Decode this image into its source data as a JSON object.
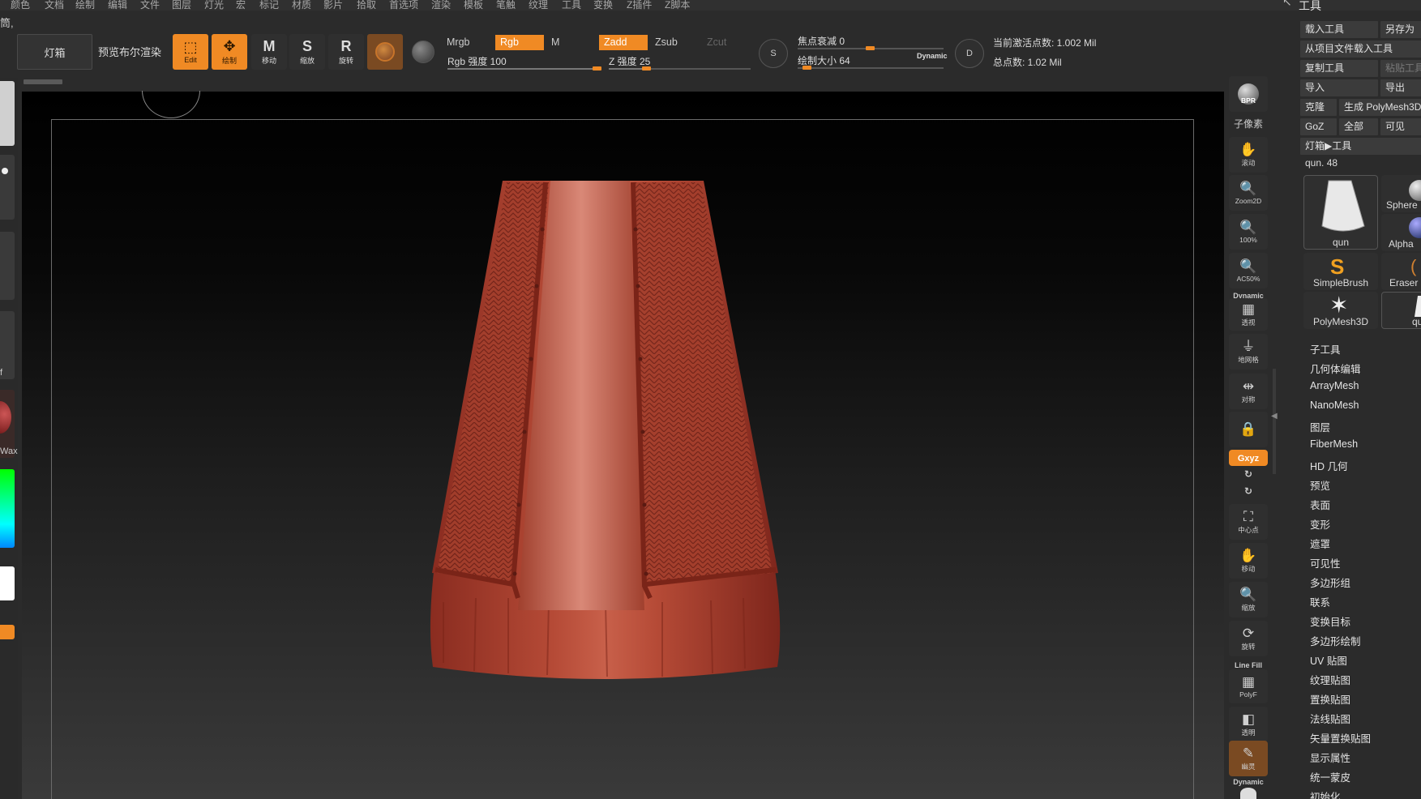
{
  "menubar": {
    "items": [
      "颜色",
      "文档",
      "绘制",
      "编辑",
      "文件",
      "图层",
      "灯光",
      "宏",
      "标记",
      "材质",
      "影片",
      "拾取",
      "首选项",
      "渲染",
      "模板",
      "笔触",
      "纹理",
      "工具",
      "变换",
      "Z插件",
      "Z脚本"
    ],
    "right_title": "工具"
  },
  "subtitle_glyph": "筒,",
  "shelf": {
    "lightbox_label": "灯箱",
    "preview_render_label": "预览布尔渲染",
    "edit_label": "Edit",
    "draw_label": "绘制",
    "move_label": "移动",
    "scale_label": "缩放",
    "rotate_label": "旋转",
    "move_letter": "M",
    "scale_letter": "S",
    "rotate_letter": "R",
    "mrgb": "Mrgb",
    "rgb": "Rgb",
    "m": "M",
    "zadd": "Zadd",
    "zsub": "Zsub",
    "zcut": "Zcut",
    "rgb_intensity_label": "Rgb 强度 100",
    "rgb_intensity_value": 100,
    "z_intensity_label": "Z 强度 25",
    "z_intensity_value": 25,
    "focal_shift_label": "焦点衰减 0",
    "focal_shift_value": 0,
    "draw_size_label": "绘制大小 64",
    "draw_size_value": 64,
    "dynamic_label": "Dynamic",
    "s_label": "S",
    "d_label": "D",
    "active_points": "当前激活点数: 1.002 Mil",
    "total_points": "总点数: 1.02 Mil"
  },
  "left_tray": {
    "wax_label": "Wax",
    "f_label": "f"
  },
  "right_bar": {
    "bpr": "BPR",
    "subpixel": "子像素",
    "scroll": "滚动",
    "zoom2d": "Zoom2D",
    "pct100": "100%",
    "ac50": "AC50%",
    "dynamic": "Dynamic",
    "persp": "透视",
    "floor": "地网格",
    "sym": "对称",
    "lock": "",
    "xyz": "Gxyz",
    "center": "中心点",
    "move": "移动",
    "scale": "缩放",
    "rotate": "旋转",
    "linefill": "Line Fill",
    "polyf": "PolyF",
    "transp": "透明",
    "ghost": "幽灵",
    "dynamic2": "Dynamic"
  },
  "tool_panel": {
    "load_tool": "载入工具",
    "save_as": "另存为",
    "load_from_project": "从项目文件载入工具",
    "copy_tool": "复制工具",
    "paste_tool": "粘贴工具",
    "import": "导入",
    "export": "导出",
    "clone": "克隆",
    "make_polymesh": "生成 PolyMesh3D",
    "goz": "GoZ",
    "all": "全部",
    "visible": "可见",
    "lightbox_tool": "灯箱▶工具",
    "current_tool": "qun. 48",
    "thumbs": [
      {
        "label": "qun"
      },
      {
        "label": "Sphere"
      },
      {
        "label": "Alpha"
      },
      {
        "label": "SimpleBrush"
      },
      {
        "label": "Eraser"
      },
      {
        "label": "PolyMesh3D"
      },
      {
        "label": "qu"
      }
    ],
    "sections": [
      "子工具",
      "几何体编辑",
      "ArrayMesh",
      "NanoMesh",
      "图层",
      "FiberMesh",
      "HD 几何",
      "预览",
      "表面",
      "变形",
      "遮罩",
      "可见性",
      "多边形组",
      "联系",
      "变换目标",
      "多边形绘制",
      "UV 贴图",
      "纹理贴图",
      "置换贴图",
      "法线贴图",
      "矢量置换贴图",
      "显示属性",
      "统一蒙皮",
      "初始化"
    ]
  },
  "colors": {
    "accent": "#f08a24",
    "clay": "#b84a38",
    "panel_bg": "#2b2b2b"
  }
}
